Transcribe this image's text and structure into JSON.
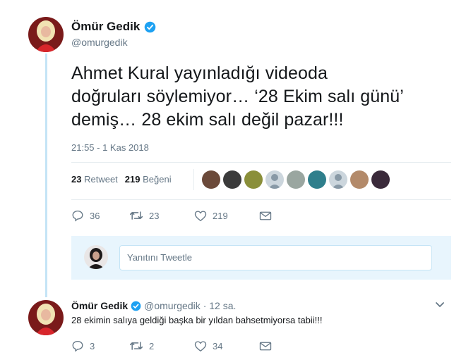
{
  "main_tweet": {
    "author_name": "Ömür Gedik",
    "handle": "@omurgedik",
    "text_lines": [
      "Ahmet Kural yayınladığı videoda",
      "doğruları söylemiyor… ‘28 Ekim salı günü’",
      "demiş… 28 ekim salı değil pazar!!!"
    ],
    "timestamp": "21:55 - 1 Kas 2018",
    "retweet_count": "23",
    "retweet_label": "Retweet",
    "like_count": "219",
    "like_label": "Beğeni",
    "actions": {
      "reply": "36",
      "retweet": "23",
      "like": "219"
    }
  },
  "reply_box": {
    "placeholder": "Yanıtını Tweetle"
  },
  "reply_tweet": {
    "author_name": "Ömür Gedik",
    "handle": "@omurgedik",
    "time": "· 12 sa.",
    "text": "28 ekimin salıya geldiği başka bir yıldan bahsetmiyorsa tabii!!!",
    "actions": {
      "reply": "3",
      "retweet": "2",
      "like": "34"
    }
  },
  "colors": {
    "accent": "#1da1f2",
    "thread_line": "#c4e4f6",
    "muted": "#657786"
  },
  "icons": [
    "verified-badge-icon",
    "reply-icon",
    "retweet-icon",
    "like-icon",
    "message-icon",
    "chevron-down-icon"
  ]
}
